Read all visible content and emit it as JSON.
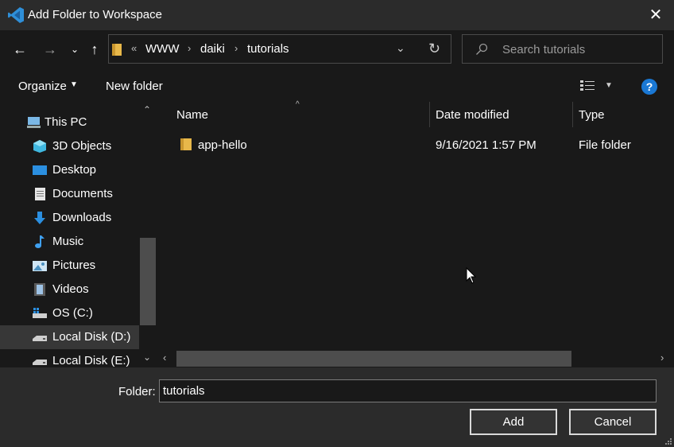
{
  "window": {
    "title": "Add Folder to Workspace"
  },
  "nav": {
    "breadcrumb": [
      "WWW",
      "daiki",
      "tutorials"
    ],
    "overflow": "«",
    "search_placeholder": "Search tutorials"
  },
  "toolbar": {
    "organize": "Organize",
    "new_folder": "New folder",
    "help": "?"
  },
  "sidebar": {
    "items": [
      {
        "label": "This PC",
        "icon": "pc-icon"
      },
      {
        "label": "3D Objects",
        "icon": "cube-icon"
      },
      {
        "label": "Desktop",
        "icon": "desktop-icon"
      },
      {
        "label": "Documents",
        "icon": "documents-icon"
      },
      {
        "label": "Downloads",
        "icon": "download-icon"
      },
      {
        "label": "Music",
        "icon": "music-icon"
      },
      {
        "label": "Pictures",
        "icon": "pictures-icon"
      },
      {
        "label": "Videos",
        "icon": "videos-icon"
      },
      {
        "label": "OS (C:)",
        "icon": "os-drive-icon"
      },
      {
        "label": "Local Disk (D:)",
        "icon": "disk-icon"
      },
      {
        "label": "Local Disk (E:)",
        "icon": "disk-icon"
      }
    ]
  },
  "columns": {
    "name": "Name",
    "date": "Date modified",
    "type": "Type"
  },
  "files": [
    {
      "name": "app-hello",
      "date": "9/16/2021 1:57 PM",
      "type": "File folder"
    }
  ],
  "footer": {
    "folder_label": "Folder:",
    "folder_value": "tutorials",
    "add": "Add",
    "cancel": "Cancel"
  }
}
